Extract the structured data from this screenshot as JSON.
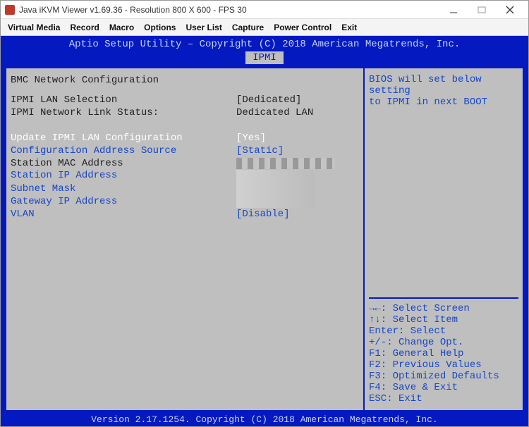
{
  "window": {
    "title": "Java iKVM Viewer v1.69.36              - Resolution 800 X 600 - FPS 30"
  },
  "menubar": {
    "items": [
      "Virtual Media",
      "Record",
      "Macro",
      "Options",
      "User List",
      "Capture",
      "Power Control",
      "Exit"
    ]
  },
  "bios": {
    "header": "Aptio Setup Utility – Copyright (C) 2018 American Megatrends, Inc.",
    "tab": "IPMI",
    "section_title": "BMC Network Configuration",
    "rows": [
      {
        "label": "IPMI LAN Selection",
        "value": "[Dedicated]",
        "style": "grey"
      },
      {
        "label": "IPMI Network Link Status:",
        "value": "Dedicated LAN",
        "style": "grey"
      },
      {
        "label": " ",
        "value": " ",
        "style": "grey"
      },
      {
        "label": "Update IPMI LAN Configuration",
        "value": "[Yes]",
        "style": "sel"
      },
      {
        "label": "Configuration Address Source",
        "value": "[Static]",
        "style": "blue"
      },
      {
        "label": "Station MAC Address",
        "value": "",
        "style": "grey",
        "pix": true
      },
      {
        "label": "Station IP Address",
        "value": "",
        "style": "blue",
        "pix2": true
      },
      {
        "label": "Subnet Mask",
        "value": "",
        "style": "blue"
      },
      {
        "label": "Gateway IP Address",
        "value": "",
        "style": "blue"
      },
      {
        "label": "VLAN",
        "value": "[Disable]",
        "style": "blue"
      }
    ],
    "help": "BIOS will set below setting\nto IPMI in next BOOT",
    "keys": [
      "→←: Select Screen",
      "↑↓: Select Item",
      "Enter: Select",
      "+/-: Change Opt.",
      "F1: General Help",
      "F2: Previous Values",
      "F3: Optimized Defaults",
      "F4: Save & Exit",
      "ESC: Exit"
    ],
    "footer": "Version 2.17.1254. Copyright (C) 2018 American Megatrends, Inc."
  }
}
